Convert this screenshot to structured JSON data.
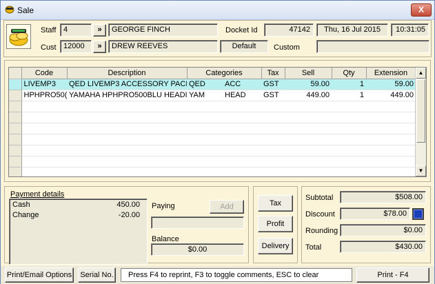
{
  "window": {
    "title": "Sale",
    "close_label": "X"
  },
  "header": {
    "staff_label": "Staff",
    "staff_code": "4",
    "staff_name": "GEORGE  FINCH",
    "cust_label": "Cust",
    "cust_code": "12000",
    "cust_name": "DREW REEVES",
    "lookup_label": "»",
    "docket_label": "Docket Id",
    "docket_id": "47142",
    "date": "Thu, 16 Jul 2015",
    "time": "10:31:05",
    "price_level": "Default",
    "custom_label": "Custom",
    "custom_value": ""
  },
  "grid": {
    "columns": [
      "Code",
      "Description",
      "Categories",
      "Tax",
      "Sell",
      "Qty",
      "Extension"
    ],
    "rows": [
      {
        "code": "LIVEMP3",
        "desc": "QED LIVEMP3 ACCESSORY PACK",
        "cat1": "QED",
        "cat2": "ACC",
        "tax": "GST",
        "sell": "59.00",
        "qty": "1",
        "ext": "59.00"
      },
      {
        "code": "HPHPRO50(",
        "desc": "YAMAHA HPHPRO500BLU HEADI",
        "cat1": "YAM",
        "cat2": "HEAD",
        "tax": "GST",
        "sell": "449.00",
        "qty": "1",
        "ext": "449.00"
      }
    ]
  },
  "payment": {
    "title": "Payment details",
    "items": [
      {
        "label": "Cash",
        "value": "450.00"
      },
      {
        "label": "Change",
        "value": "-20.00"
      }
    ],
    "paying_label": "Paying",
    "add_label": "Add",
    "paying_value": "",
    "balance_label": "Balance",
    "balance_value": "$0.00"
  },
  "actions": {
    "tax": "Tax",
    "profit": "Profit",
    "delivery": "Delivery"
  },
  "totals": {
    "subtotal_label": "Subtotal",
    "subtotal": "$508.00",
    "discount_label": "Discount",
    "discount": "$78.00",
    "rounding_label": "Rounding",
    "rounding": "$0.00",
    "total_label": "Total",
    "total": "$430.00"
  },
  "footer": {
    "print_email": "Print/Email Options",
    "serial": "Serial No.",
    "hint": "Press F4 to reprint, F3 to toggle comments, ESC to clear",
    "print": "Print - F4"
  }
}
